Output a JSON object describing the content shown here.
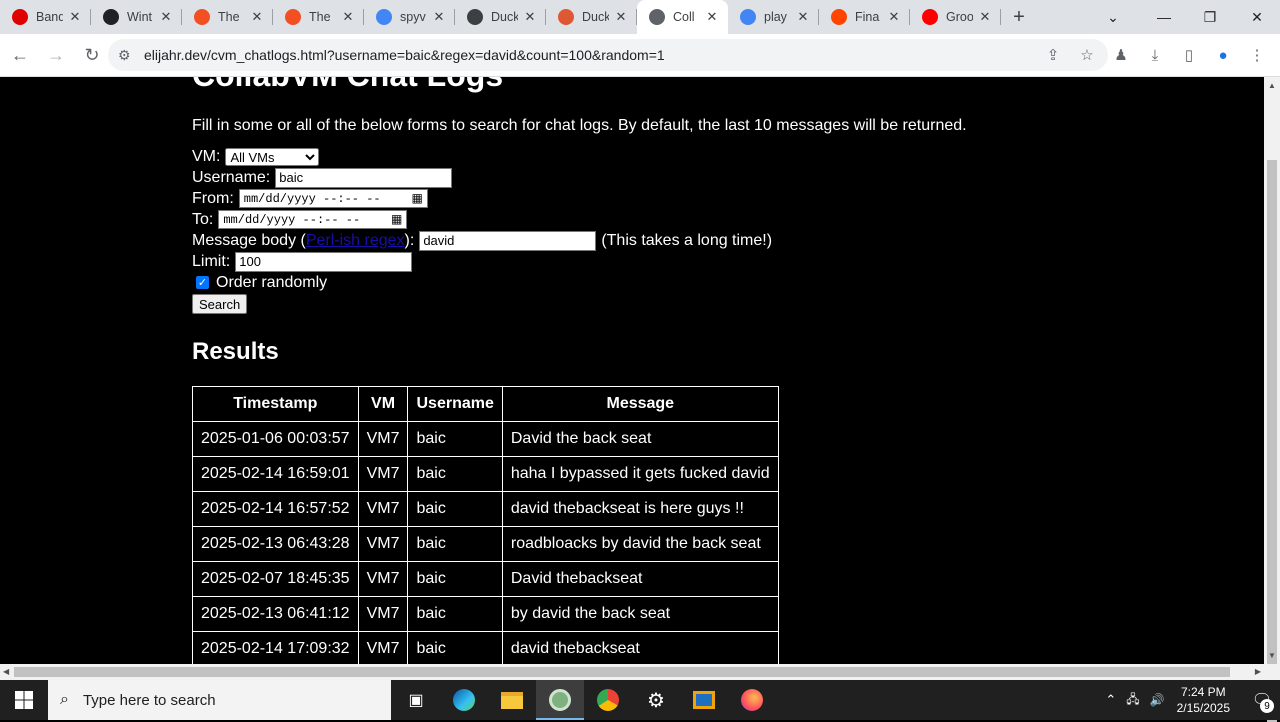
{
  "tabs": [
    {
      "title": "Band",
      "icon": "record-icon",
      "color": "#e00000"
    },
    {
      "title": "Wint",
      "icon": "wikipedia-icon",
      "color": "#202124"
    },
    {
      "title": "The",
      "icon": "windows-icon",
      "color": "#f25022"
    },
    {
      "title": "The",
      "icon": "windows-icon",
      "color": "#f25022"
    },
    {
      "title": "spyv",
      "icon": "google-icon",
      "color": "#4285f4"
    },
    {
      "title": "Duck",
      "icon": "duck-icon",
      "color": "#3c4043"
    },
    {
      "title": "Duck",
      "icon": "duckduckgo-icon",
      "color": "#de5833"
    },
    {
      "title": "Coll",
      "icon": "globe-icon",
      "color": "#5f6368",
      "active": true
    },
    {
      "title": "play",
      "icon": "google-icon",
      "color": "#4285f4"
    },
    {
      "title": "Fina",
      "icon": "reddit-icon",
      "color": "#ff4500"
    },
    {
      "title": "Groo",
      "icon": "youtube-icon",
      "color": "#ff0000"
    }
  ],
  "address": {
    "url": "elijahr.dev/cvm_chatlogs.html?username=baic&regex=david&count=100&random=1"
  },
  "page": {
    "heading": "CollabVM Chat Logs",
    "intro": "Fill in some or all of the below forms to search for chat logs. By default, the last 10 messages will be returned.",
    "form": {
      "vm_label": "VM:",
      "vm_selected": "All VMs",
      "username_label": "Username:",
      "username_value": "baic",
      "from_label": "From:",
      "to_label": "To:",
      "datetime_placeholder": "mm/dd/yyyy --:-- --",
      "message_label_prefix": "Message body (",
      "message_link": "Perl-ish regex",
      "message_label_suffix": "):",
      "message_value": "david",
      "message_note": "(This takes a long time!)",
      "limit_label": "Limit:",
      "limit_value": "100",
      "random_label": "Order randomly",
      "search_button": "Search"
    },
    "results_heading": "Results",
    "table": {
      "headers": [
        "Timestamp",
        "VM",
        "Username",
        "Message"
      ],
      "rows": [
        [
          "2025-01-06 00:03:57",
          "VM7",
          "baic",
          "David the back seat"
        ],
        [
          "2025-02-14 16:59:01",
          "VM7",
          "baic",
          "haha I bypassed it gets fucked david"
        ],
        [
          "2025-02-14 16:57:52",
          "VM7",
          "baic",
          "david thebackseat is here guys !!"
        ],
        [
          "2025-02-13 06:43:28",
          "VM7",
          "baic",
          "roadbloacks by david the back seat"
        ],
        [
          "2025-02-07 18:45:35",
          "VM7",
          "baic",
          "David thebackseat"
        ],
        [
          "2025-02-13 06:41:12",
          "VM7",
          "baic",
          "by david the back seat"
        ],
        [
          "2025-02-14 17:09:32",
          "VM7",
          "baic",
          "david thebackseat"
        ]
      ]
    }
  },
  "taskbar": {
    "search_placeholder": "Type here to search",
    "time": "7:24 PM",
    "date": "2/15/2025",
    "notifications": "9"
  }
}
